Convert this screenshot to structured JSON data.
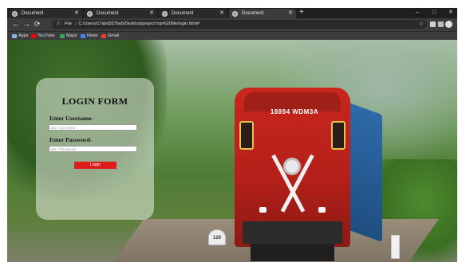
{
  "browser": {
    "tabs": [
      {
        "title": "Document",
        "active": false
      },
      {
        "title": "Document",
        "active": false
      },
      {
        "title": "Document",
        "active": false
      },
      {
        "title": "Document",
        "active": true
      }
    ],
    "new_tab_glyph": "+",
    "window_controls": {
      "minimize": "–",
      "maximize": "□",
      "close": "✕"
    },
    "nav": {
      "back": "←",
      "forward": "→",
      "reload": "⟳"
    },
    "address": {
      "info_icon": "info-icon",
      "prefix": "File",
      "url": "C:/Users/17abd337ba5/Desktop/project top%20file/login.html#"
    },
    "bookmarks": [
      {
        "label": "Apps",
        "icon": "apps-grid-icon",
        "color": "#8ab4f8"
      },
      {
        "label": "YouTube",
        "icon": "youtube-icon",
        "color": "#ff0000"
      },
      {
        "label": "Maps",
        "icon": "maps-icon",
        "color": "#34a853"
      },
      {
        "label": "News",
        "icon": "news-icon",
        "color": "#4285f4"
      },
      {
        "label": "Gmail",
        "icon": "gmail-icon",
        "color": "#ea4335"
      }
    ]
  },
  "page": {
    "background": {
      "loco_number": "18894 WDM3A",
      "milestone": "120"
    },
    "login": {
      "title": "LOGIN FORM",
      "username_label": "Enter Username-",
      "username_placeholder": "abc / xyz name",
      "password_label": "Enter Password-",
      "password_placeholder": "abc / Password",
      "button_label": "Login",
      "button_color": "#e01b1b"
    }
  }
}
